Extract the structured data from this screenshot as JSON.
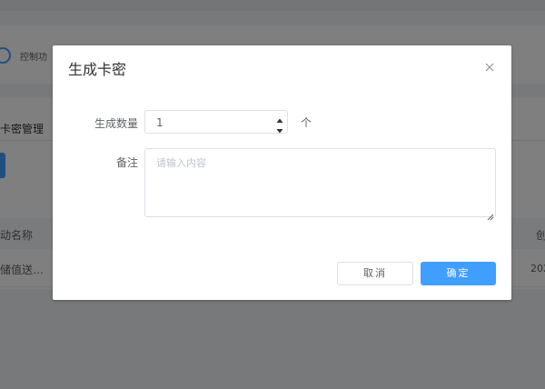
{
  "background": {
    "toggle_label": "控制功",
    "tab_label": "卡密管理",
    "table": {
      "col1_header": "动名称",
      "col2_header": "创",
      "row1_col1": "储值送…",
      "row1_col2": "202"
    }
  },
  "dialog": {
    "title": "生成卡密",
    "quantity_label": "生成数量",
    "quantity_value": "1",
    "quantity_unit": "个",
    "note_label": "备注",
    "note_placeholder": "请输入内容",
    "cancel_label": "取消",
    "confirm_label": "确定"
  },
  "colors": {
    "primary": "#409eff",
    "overlay": "rgba(0,0,0,0.5)"
  }
}
